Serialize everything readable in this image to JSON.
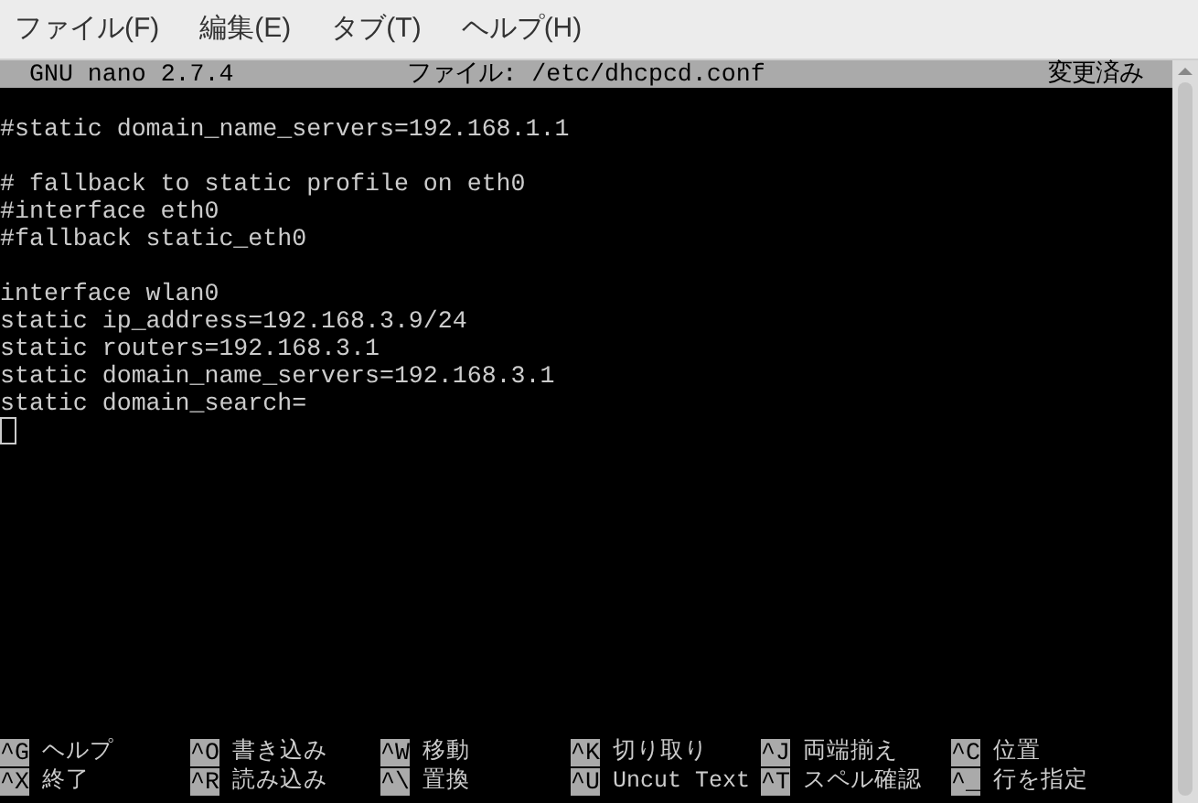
{
  "menubar": [
    "ファイル(F)",
    "編集(E)",
    "タブ(T)",
    "ヘルプ(H)"
  ],
  "titlebar": {
    "left": "GNU nano 2.7.4",
    "center": "ファイル: /etc/dhcpcd.conf",
    "right": "変更済み"
  },
  "blocks": [
    [
      "#static domain_name_servers=192.168.1.1"
    ],
    [
      "# fallback to static profile on eth0",
      "#interface eth0",
      "#fallback static_eth0"
    ],
    [
      "interface wlan0",
      "static ip_address=192.168.3.9/24",
      "static routers=192.168.3.1",
      "static domain_name_servers=192.168.3.1",
      "static domain_search="
    ]
  ],
  "shortcuts": [
    [
      {
        "key": "^G",
        "label": "ヘルプ"
      },
      {
        "key": "^O",
        "label": "書き込み"
      },
      {
        "key": "^W",
        "label": "移動"
      },
      {
        "key": "^K",
        "label": "切り取り"
      },
      {
        "key": "^J",
        "label": "両端揃え"
      },
      {
        "key": "^C",
        "label": "位置"
      }
    ],
    [
      {
        "key": "^X",
        "label": "終了"
      },
      {
        "key": "^R",
        "label": "読み込み"
      },
      {
        "key": "^\\",
        "label": "置換"
      },
      {
        "key": "^U",
        "label": "Uncut Text"
      },
      {
        "key": "^T",
        "label": "スペル確認"
      },
      {
        "key": "^_",
        "label": "行を指定"
      }
    ]
  ]
}
